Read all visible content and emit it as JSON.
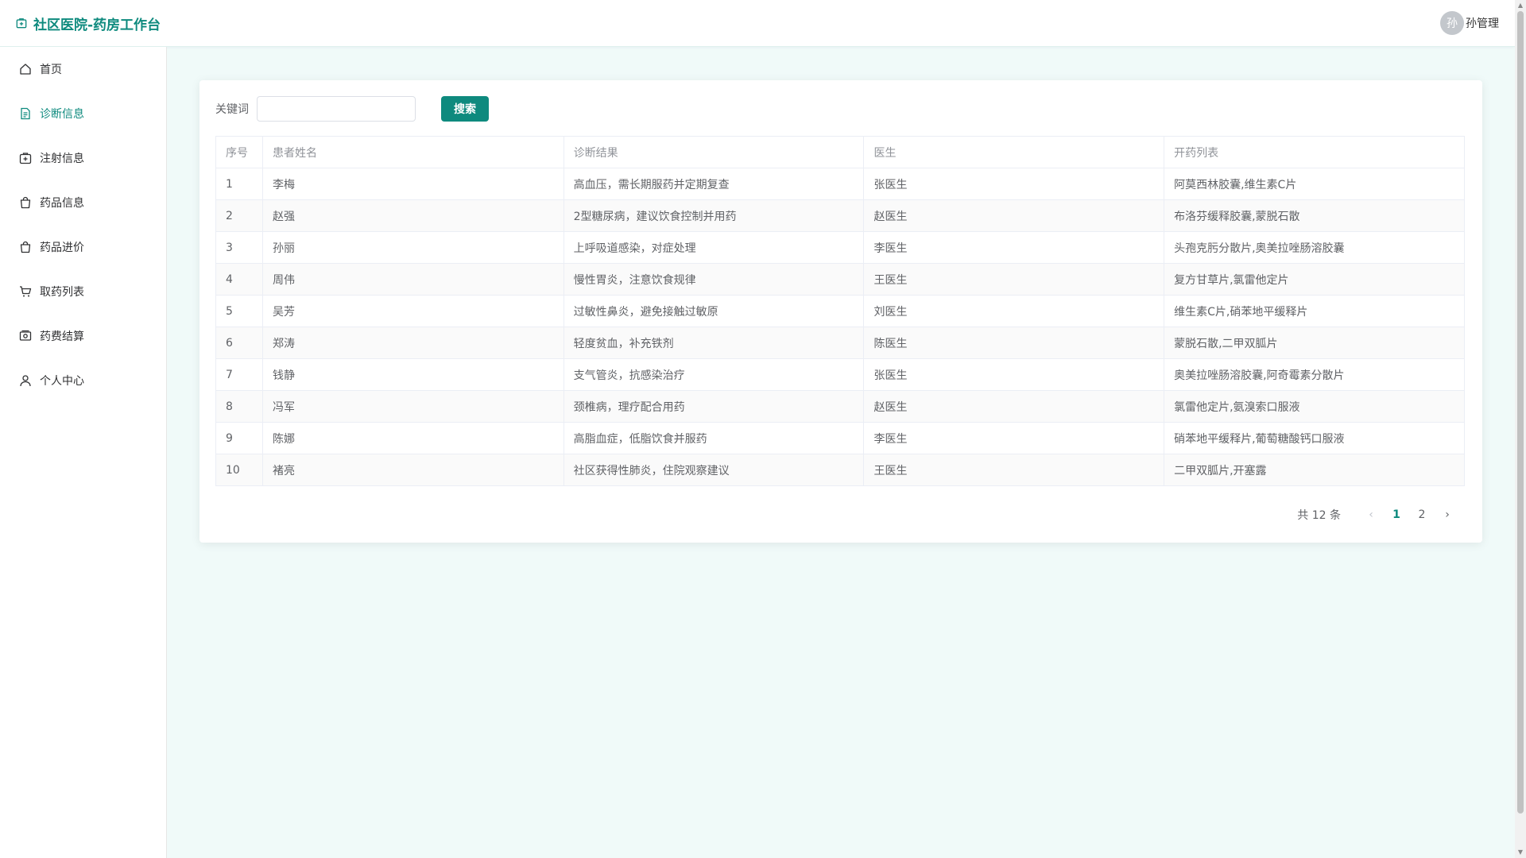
{
  "header": {
    "title": "社区医院-药房工作台",
    "user": {
      "avatar_text": "孙",
      "name": "孙管理"
    }
  },
  "sidebar": {
    "items": [
      {
        "label": "首页",
        "icon": "home-icon"
      },
      {
        "label": "诊断信息",
        "icon": "document-icon",
        "active": true
      },
      {
        "label": "注射信息",
        "icon": "medical-kit-icon"
      },
      {
        "label": "药品信息",
        "icon": "shopping-bag-icon"
      },
      {
        "label": "药品进价",
        "icon": "shopping-bag-icon"
      },
      {
        "label": "取药列表",
        "icon": "cart-icon"
      },
      {
        "label": "药费结算",
        "icon": "money-icon"
      },
      {
        "label": "个人中心",
        "icon": "user-icon"
      }
    ]
  },
  "search": {
    "label": "关键词",
    "value": "",
    "placeholder": "",
    "button": "搜索"
  },
  "table": {
    "headers": [
      "序号",
      "患者姓名",
      "诊断结果",
      "医生",
      "开药列表"
    ],
    "rows": [
      [
        "1",
        "李梅",
        "高血压，需长期服药并定期复查",
        "张医生",
        "阿莫西林胶囊,维生素C片"
      ],
      [
        "2",
        "赵强",
        "2型糖尿病，建议饮食控制并用药",
        "赵医生",
        "布洛芬缓释胶囊,蒙脱石散"
      ],
      [
        "3",
        "孙丽",
        "上呼吸道感染，对症处理",
        "李医生",
        "头孢克肟分散片,奥美拉唑肠溶胶囊"
      ],
      [
        "4",
        "周伟",
        "慢性胃炎，注意饮食规律",
        "王医生",
        "复方甘草片,氯雷他定片"
      ],
      [
        "5",
        "吴芳",
        "过敏性鼻炎，避免接触过敏原",
        "刘医生",
        "维生素C片,硝苯地平缓释片"
      ],
      [
        "6",
        "郑涛",
        "轻度贫血，补充铁剂",
        "陈医生",
        "蒙脱石散,二甲双胍片"
      ],
      [
        "7",
        "钱静",
        "支气管炎，抗感染治疗",
        "张医生",
        "奥美拉唑肠溶胶囊,阿奇霉素分散片"
      ],
      [
        "8",
        "冯军",
        "颈椎病，理疗配合用药",
        "赵医生",
        "氯雷他定片,氨溴索口服液"
      ],
      [
        "9",
        "陈娜",
        "高脂血症，低脂饮食并服药",
        "李医生",
        "硝苯地平缓释片,葡萄糖酸钙口服液"
      ],
      [
        "10",
        "褚亮",
        "社区获得性肺炎，住院观察建议",
        "王医生",
        "二甲双胍片,开塞露"
      ]
    ]
  },
  "pagination": {
    "total": "共 12 条",
    "pages": [
      "1",
      "2"
    ],
    "current": "1"
  },
  "colors": {
    "accent": "#0e8a7e",
    "background": "#f0faf9"
  }
}
